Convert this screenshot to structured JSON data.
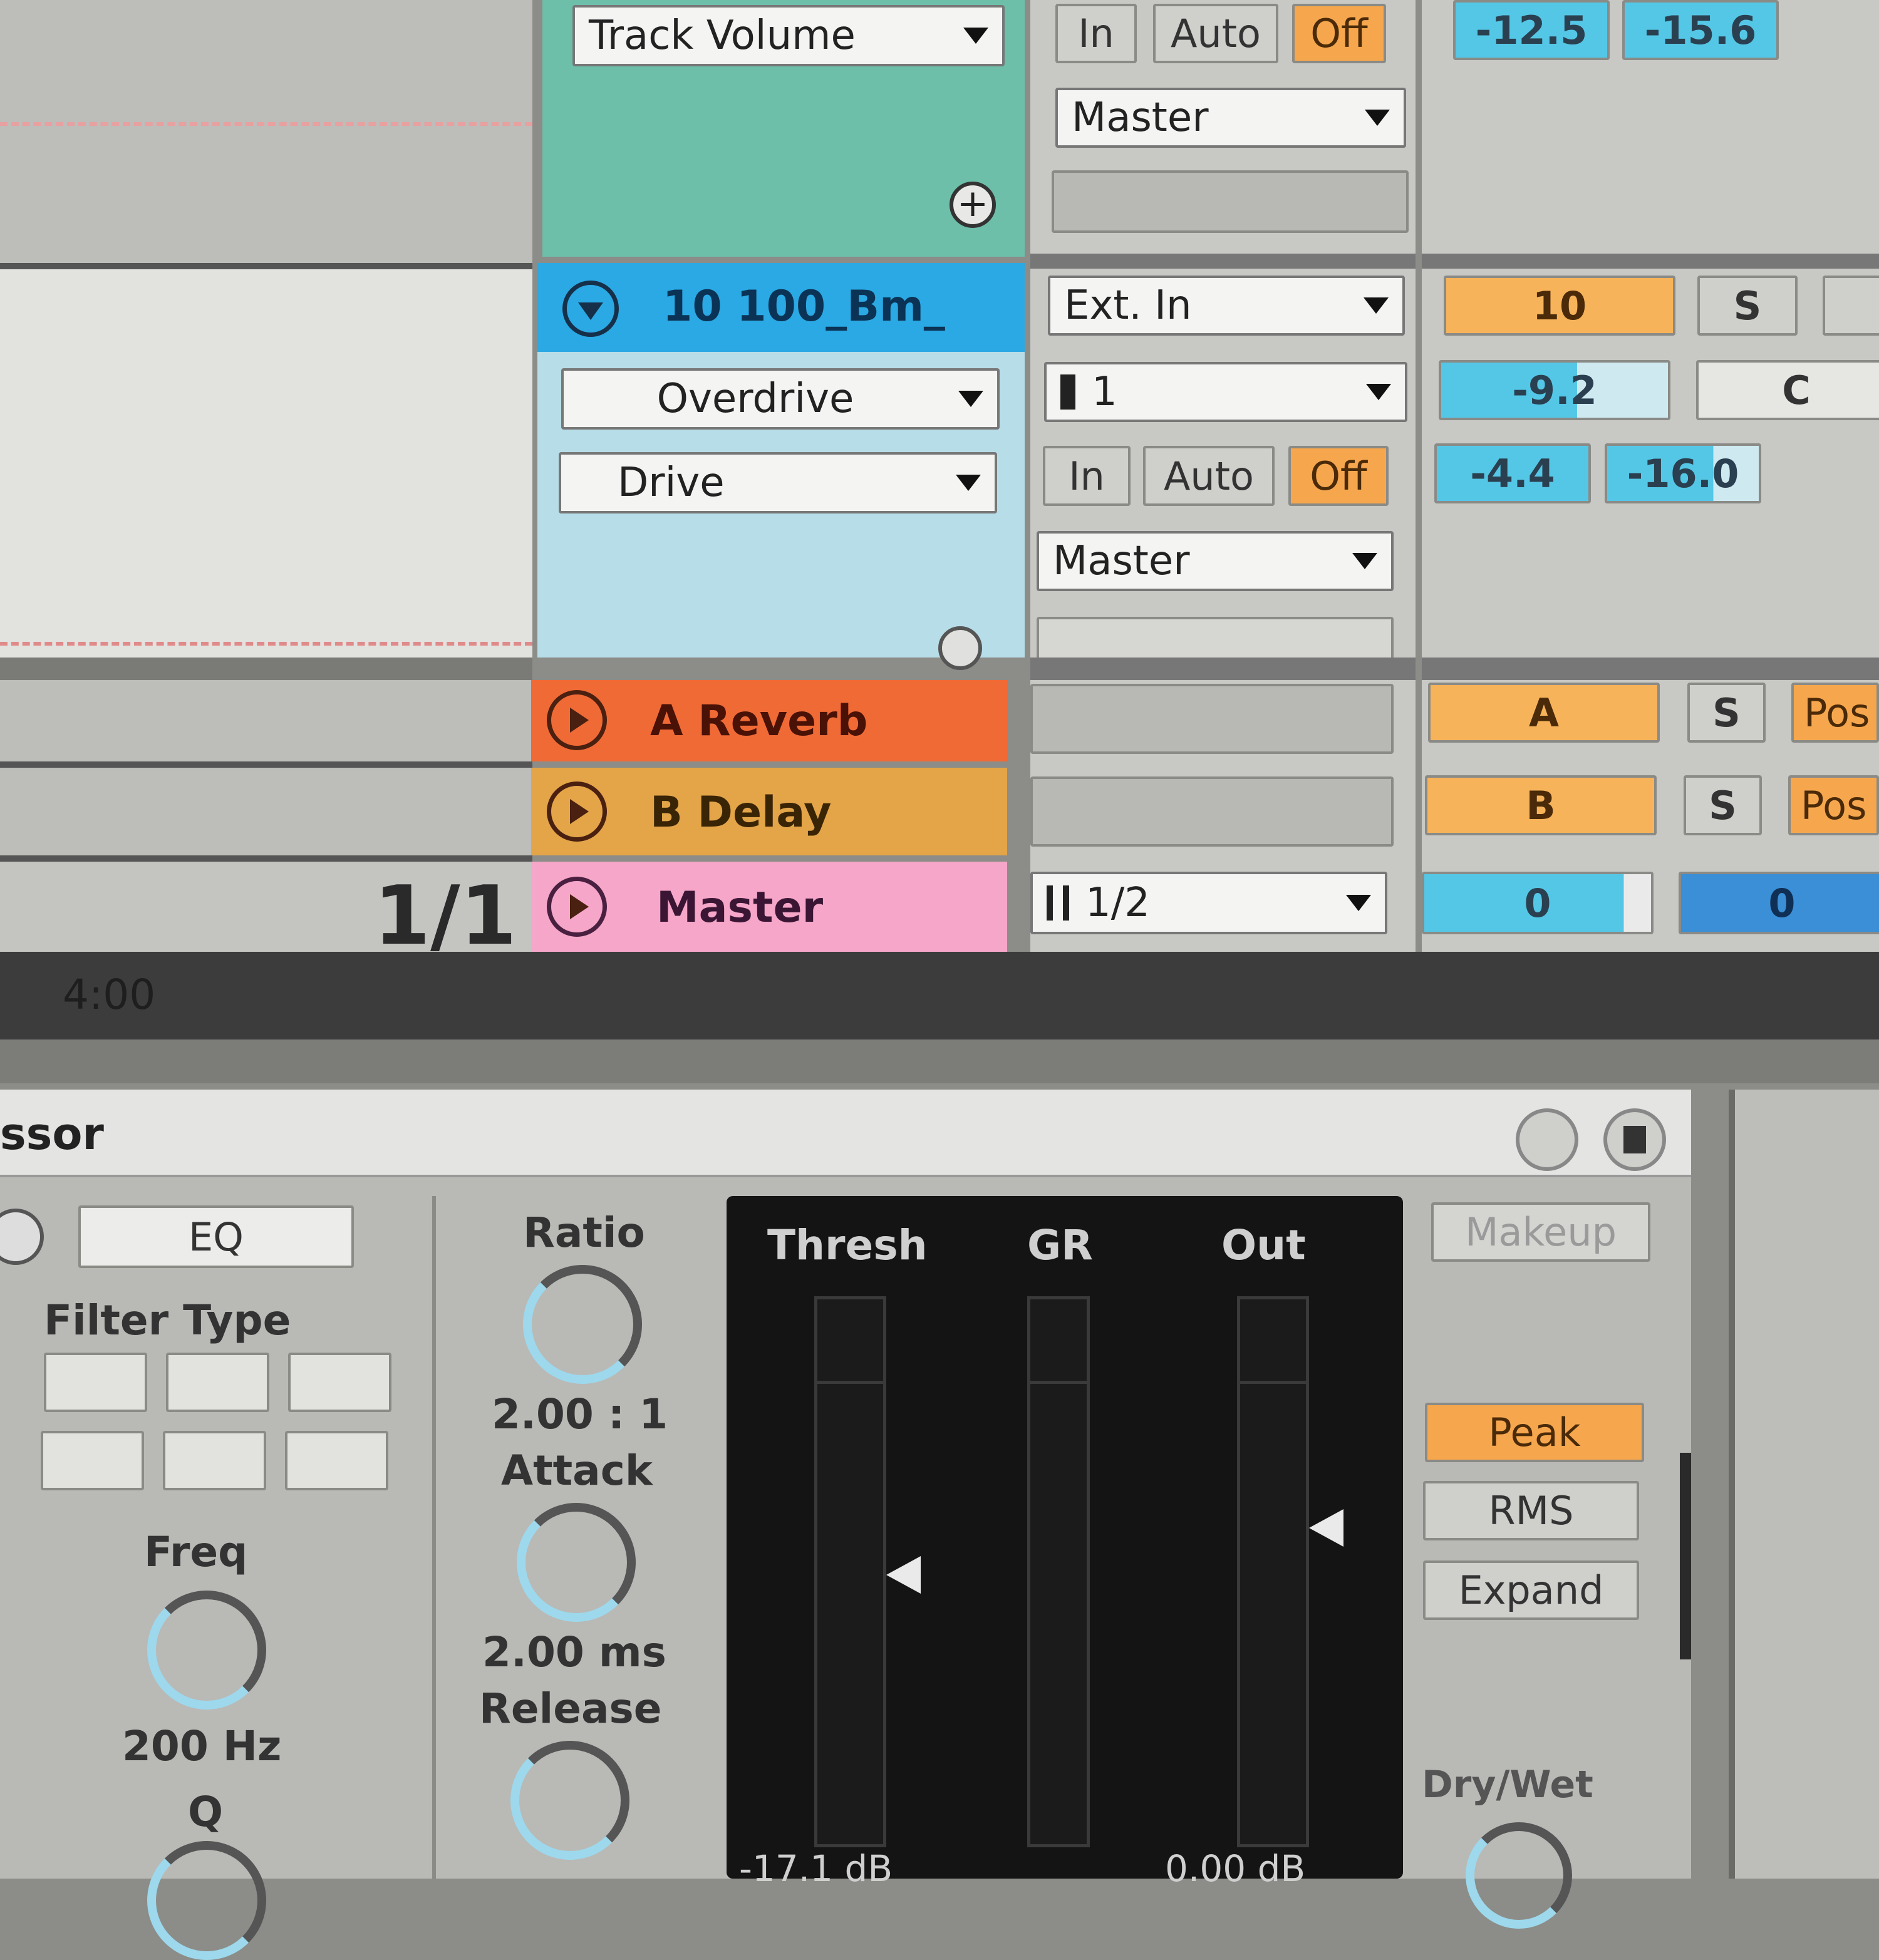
{
  "tracks": {
    "track_top": {
      "device_select": "Track Volume",
      "monitor": {
        "in": "In",
        "auto": "Auto",
        "off": "Off"
      },
      "output": "Master",
      "meters": [
        "-12.5",
        "-15.6"
      ]
    },
    "track_10": {
      "name": "10 100_Bm_",
      "device_select": "Overdrive",
      "param_select": "Drive",
      "input_type": "Ext. In",
      "input_channel": "1",
      "monitor": {
        "in": "In",
        "auto": "Auto",
        "off": "Off"
      },
      "output": "Master",
      "track_number": "10",
      "solo": "S",
      "pan": "C",
      "volume": "-9.2",
      "meters": [
        "-4.4",
        "-16.0"
      ]
    },
    "return_a": {
      "name": "A Reverb",
      "letter": "A",
      "solo": "S",
      "post": "Pos"
    },
    "return_b": {
      "name": "B Delay",
      "letter": "B",
      "solo": "S",
      "post": "Pos"
    },
    "master": {
      "name": "Master",
      "cue_out": "1/2",
      "meters": [
        "0",
        "0"
      ]
    }
  },
  "arrangement": {
    "time_signature": "1/1",
    "time_marker": "4:00"
  },
  "device": {
    "title": "ssor",
    "eq_label": "EQ",
    "filter_type_label": "Filter Type",
    "freq_label": "Freq",
    "freq_value": "200 Hz",
    "q_label": "Q",
    "ratio_label": "Ratio",
    "ratio_value": "2.00 : 1",
    "attack_label": "Attack",
    "attack_value": "2.00 ms",
    "release_label": "Release",
    "meters": {
      "thresh": "Thresh",
      "gr": "GR",
      "out": "Out"
    },
    "thresh_value": "-17.1 dB",
    "out_value": "0.00 dB",
    "makeup": "Makeup",
    "peak": "Peak",
    "rms": "RMS",
    "expand": "Expand",
    "dry_wet": "Dry/Wet"
  },
  "colors": {
    "teal": "#6dbfaa",
    "light_blue": "#b7dde8",
    "selected_blue": "#2aa9e4",
    "reverb_orange": "#f06a36",
    "delay_amber": "#e3a548",
    "master_pink": "#f6a6c8"
  }
}
